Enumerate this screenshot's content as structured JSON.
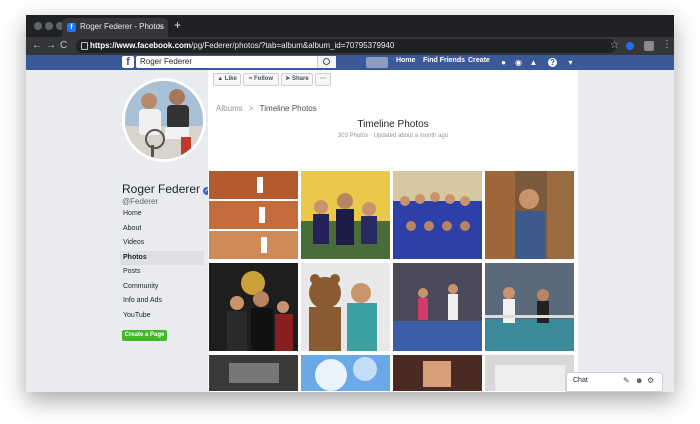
{
  "browser": {
    "tab_title": "Roger Federer - Photos",
    "tab_close": "×",
    "new_tab": "+",
    "back": "←",
    "forward": "→",
    "reload": "C",
    "url_host": "https://www.facebook.com",
    "url_path": "/pg/Federer/photos/?tab=album&album_id=70795379940",
    "star": "☆",
    "menu": "⋮"
  },
  "fb_header": {
    "logo": "f",
    "search_value": "Roger Federer",
    "nav": [
      "Home",
      "Find Friends",
      "Create"
    ],
    "help": "?",
    "caret": "▾"
  },
  "profile": {
    "name": "Roger Federer",
    "verified": "✓",
    "handle": "@Federer",
    "nav_items": [
      "Home",
      "About",
      "Videos",
      "Photos",
      "Posts",
      "Community",
      "Info and Ads",
      "YouTube"
    ],
    "active_index": 3,
    "cta_label": "Create a Page"
  },
  "page_actions": {
    "like": "Like",
    "follow": "Follow",
    "share": "Share",
    "more": "···"
  },
  "breadcrumb": {
    "parent": "Albums",
    "sep": ">",
    "current": "Timeline Photos"
  },
  "album": {
    "title": "Timeline Photos",
    "subtitle": "303 Photos · Updated about a month ago"
  },
  "chat": {
    "label": "Chat"
  },
  "colors": {
    "fb_blue": "#3b5998",
    "create_green": "#42b72a",
    "verified_blue": "#4267b2"
  }
}
